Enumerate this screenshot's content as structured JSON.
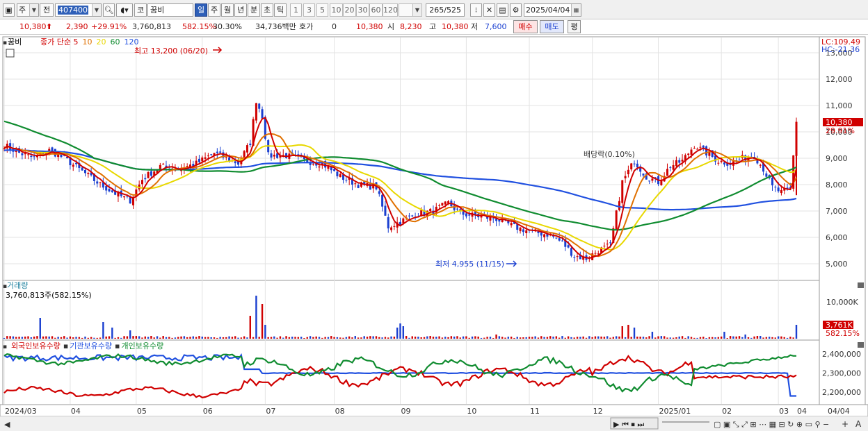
{
  "toolbar": {
    "market": "주",
    "type": "전",
    "code": "407400",
    "exchange": "코",
    "name": "꿈비",
    "periods": [
      "일",
      "주",
      "월",
      "년",
      "분",
      "초",
      "틱"
    ],
    "active_period": "일",
    "minutes": [
      "1",
      "3",
      "5",
      "10",
      "20",
      "30",
      "60",
      "120"
    ],
    "count": "265",
    "count_total": "/525",
    "date": "2025/04/04"
  },
  "quote": {
    "price": "10,380",
    "change": "2,390",
    "change_pct": "+29.91%",
    "volume": "3,760,813",
    "vol_ratio": "582.15%",
    "turnover": "30.30%",
    "amount": "34,736백만",
    "hoga_label": "호가",
    "hoga_value": "0",
    "cur_price": "10,380",
    "open_label": "시",
    "open": "8,230",
    "high_label": "고",
    "high": "10,380",
    "low_label": "저",
    "low": "7,600",
    "buy_button": "매수",
    "sell_button": "매도",
    "eval_button": "평"
  },
  "price_panel": {
    "name_tag": "꿈비",
    "legend": [
      {
        "text": "종가 단순 5",
        "color": "#d00000"
      },
      {
        "text": "10",
        "color": "#e07000"
      },
      {
        "text": "20",
        "color": "#e8d800"
      },
      {
        "text": "60",
        "color": "#108c30"
      },
      {
        "text": "120",
        "color": "#2050e0"
      }
    ],
    "high_note": "최고 13,200 (06/20)",
    "low_note": "최저 4,955 (11/15)",
    "drop_note": "배당락(0.10%)",
    "lc": "LC:109.49",
    "hc": "HC:-21.36",
    "last_price_tag": "10,380",
    "last_pct_tag": "29.91%",
    "y_labels": [
      "13,000",
      "12,000",
      "11,000",
      "10,000",
      "9,000",
      "8,000",
      "7,000",
      "6,000",
      "5,000"
    ]
  },
  "volume_panel": {
    "title": "거래량",
    "value": "3,760,813주(582.15%)",
    "y_label": "10,000K",
    "last_tag": "3,761K",
    "last_pct": "582.15%"
  },
  "holdings_panel": {
    "legend": [
      {
        "text": "외국인보유수량",
        "color": "#d00000"
      },
      {
        "text": "기관보유수량",
        "color": "#2050e0"
      },
      {
        "text": "개인보유수량",
        "color": "#108c30"
      }
    ],
    "y_labels": [
      "2,400,000",
      "2,300,000",
      "2,200,000"
    ]
  },
  "x_axis": {
    "labels": [
      "2024/03",
      "04",
      "05",
      "06",
      "07",
      "08",
      "09",
      "10",
      "11",
      "12",
      "2025/01",
      "02",
      "03",
      "04"
    ],
    "end_label": "04/04"
  },
  "colors": {
    "up": "#d00000",
    "down": "#1a3fd0",
    "ma5": "#d00000",
    "ma10": "#e07000",
    "ma20": "#e8d800",
    "ma60": "#108c30",
    "ma120": "#2050e0"
  }
}
